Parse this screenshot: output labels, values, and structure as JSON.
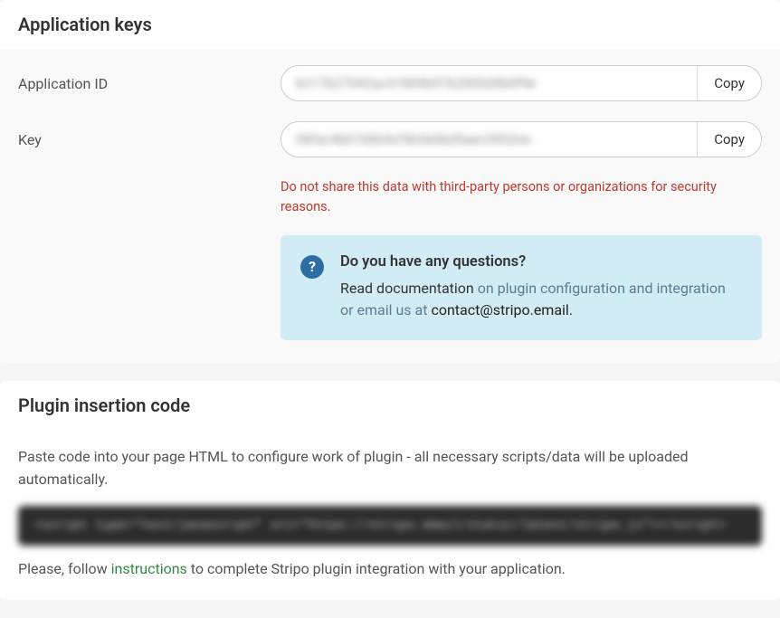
{
  "app_keys": {
    "title": "Application keys",
    "app_id_label": "Application ID",
    "app_id_value": "b217b27042ac41869b57b2000d5b0f9e",
    "key_label": "Key",
    "key_value": "08fac4bb7d0b4cf5b5e0bd5aec3002ne",
    "copy_label": "Copy",
    "warning": "Do not share this data with third-party persons or organizations for security reasons.",
    "info": {
      "title": "Do you have any questions?",
      "read_prefix": "Read documentation ",
      "doc_link": "on plugin configuration and integration",
      "or_email": " or email us at ",
      "email": "contact@stripo.email",
      "period": "."
    }
  },
  "plugin_code": {
    "title": "Plugin insertion code",
    "desc": "Paste code into your page HTML to configure work of plugin - all necessary scripts/data will be uploaded automatically.",
    "code": "<script type=\"text/javascript\" src=\"https://stripo.email/static/latest/stripo.js\"></script>",
    "follow_prefix": "Please, follow ",
    "follow_link": "instructions",
    "follow_suffix": " to complete Stripo plugin integration with your application."
  }
}
